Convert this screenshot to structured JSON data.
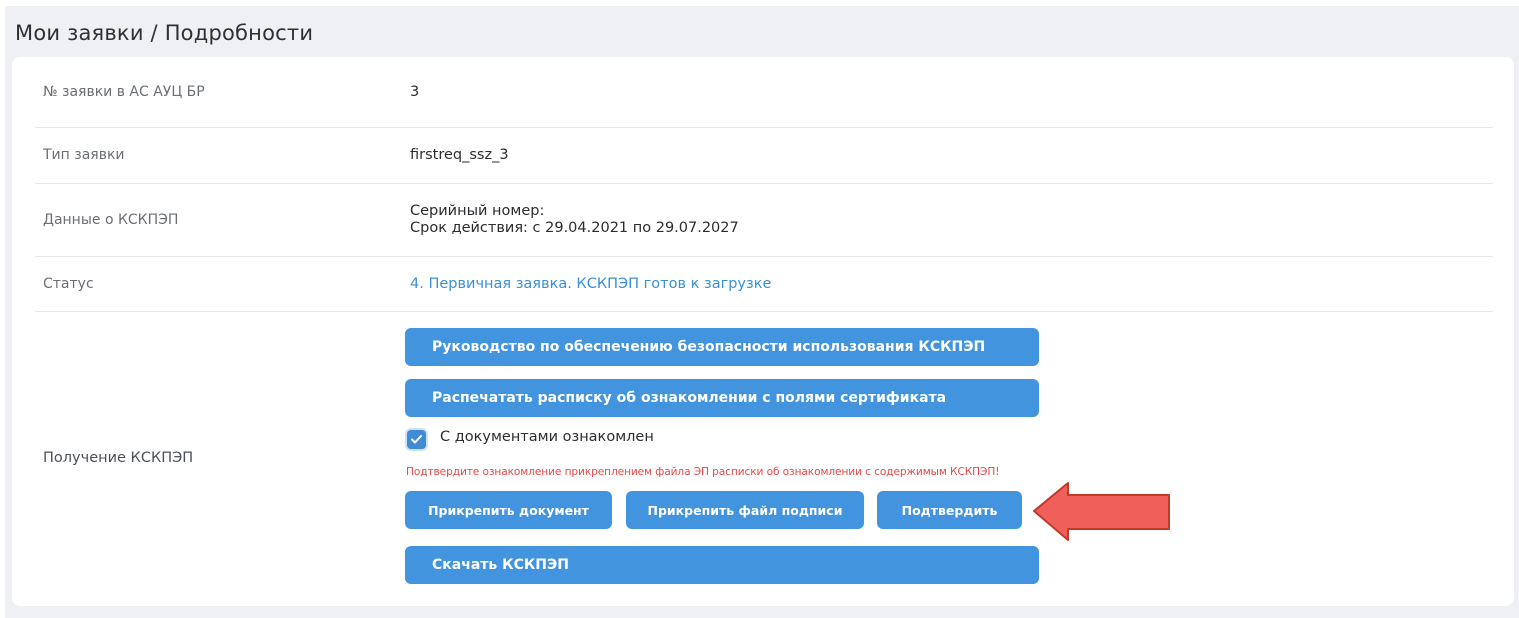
{
  "header": {
    "title": "Мои заявки / Подробности"
  },
  "details": {
    "request_number_label": "№ заявки в АС АУЦ БР",
    "request_number_value": "3",
    "request_type_label": "Тип заявки",
    "request_type_value": "firstreq_ssz_3",
    "kskpep_data_label": "Данные о КСКПЭП",
    "serial_number_text": "Серийный номер:",
    "validity_text": "Срок действия: с 29.04.2021 по 29.07.2027",
    "status_label": "Статус",
    "status_value": "4. Первичная заявка. КСКПЭП готов к загрузке",
    "receive_label": "Получение КСКПЭП"
  },
  "actions": {
    "guide_button": "Руководство по обеспечению безопасности использования КСКПЭП",
    "print_button": "Распечатать расписку об ознакомлении с полями сертификата",
    "ack_checkbox_label": "С документами ознакомлен",
    "ack_checked": true,
    "warning_text": "Подтвердите ознакомление прикреплением файла ЭП расписки об ознакомлении с содержимым КСКПЭП!",
    "attach_document_button": "Прикрепить документ",
    "attach_signature_button": "Прикрепить файл подписи",
    "confirm_button": "Подтвердить",
    "download_button": "Скачать КСКПЭП"
  },
  "colors": {
    "accent": "#4294df",
    "status_text": "#3a8fd6",
    "warning": "#e14a4a",
    "annotation_arrow": "#f0605a"
  },
  "icons": {
    "checkbox": "checkmark-icon",
    "annotation": "left-arrow-icon"
  }
}
